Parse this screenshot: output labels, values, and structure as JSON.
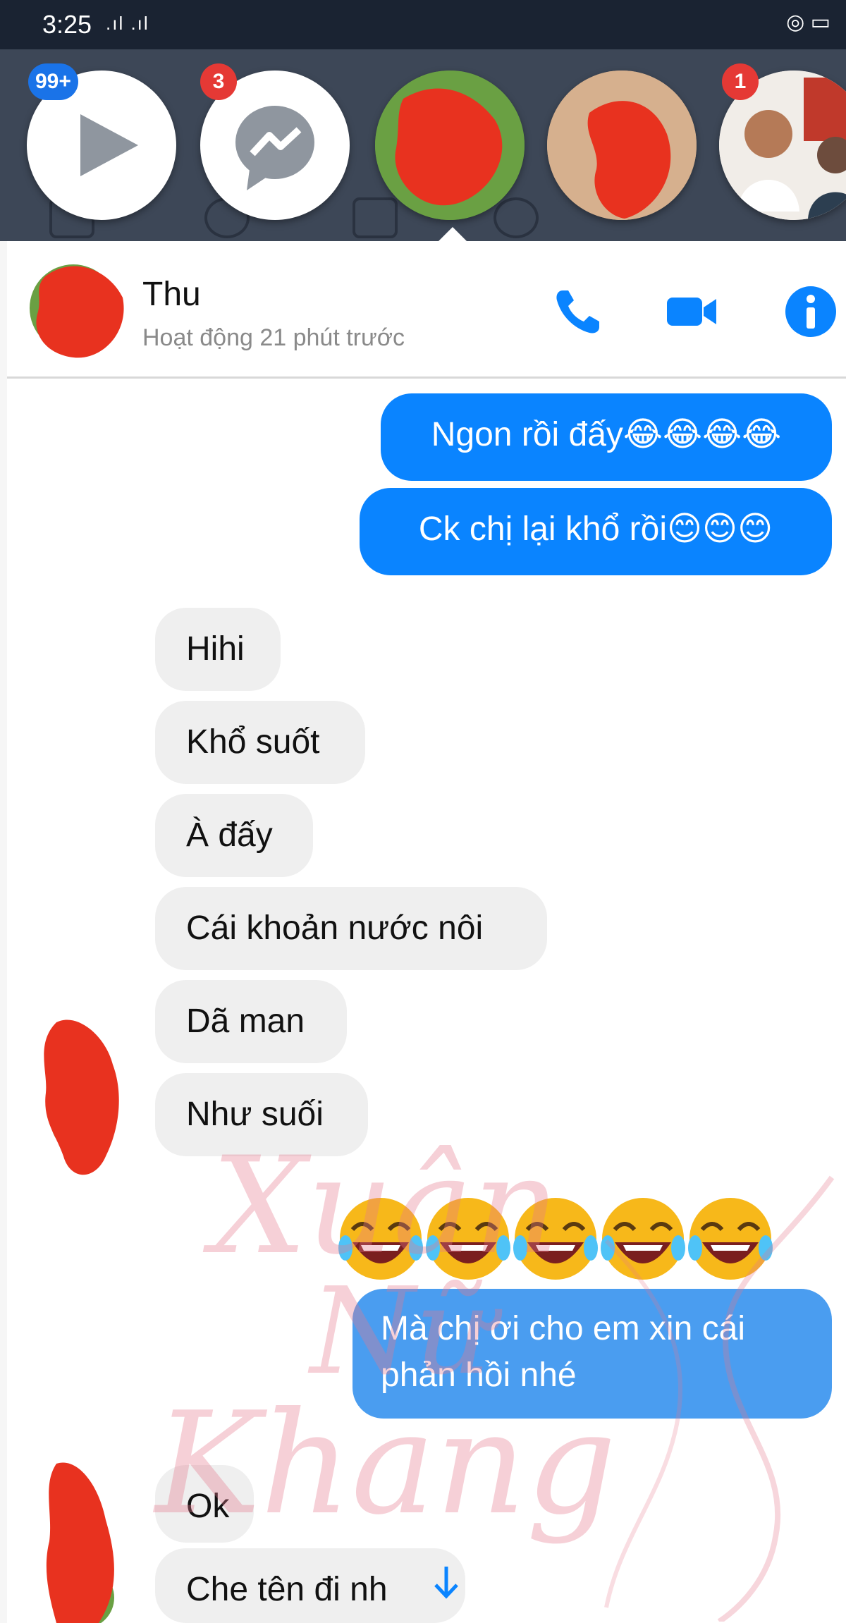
{
  "status_bar": {
    "time": "3:25",
    "signal": ".ıl .ıl",
    "right": "◎ ▭"
  },
  "chat_heads": [
    {
      "icon": "play-icon",
      "badge": "99+",
      "badge_color": "#1a73e8"
    },
    {
      "icon": "messenger-icon",
      "badge": "3",
      "badge_color": "#e53935"
    },
    {
      "icon": "avatar-redacted"
    },
    {
      "icon": "avatar-redacted"
    },
    {
      "icon": "avatar-photo",
      "badge": "1",
      "badge_color": "#e53935"
    }
  ],
  "header": {
    "name": "Thu",
    "status": "Hoạt động 21 phút trước",
    "icons": [
      "phone-icon",
      "video-icon",
      "info-icon"
    ],
    "accent": "#0a84ff"
  },
  "messages": [
    {
      "side": "out",
      "text": "Ngon rồi đấy😂😂😂😂"
    },
    {
      "side": "out",
      "text": "Ck chị lại khổ rồi😊😊😊"
    },
    {
      "side": "in",
      "text": "Hihi"
    },
    {
      "side": "in",
      "text": "Khổ suốt"
    },
    {
      "side": "in",
      "text": "À đấy"
    },
    {
      "side": "in",
      "text": "Cái khoản nước nôi"
    },
    {
      "side": "in",
      "text": "Dã man"
    },
    {
      "side": "in",
      "text": "Như suối"
    },
    {
      "side": "out-emoji",
      "text": "😂😂😂😂😂"
    },
    {
      "side": "out",
      "text_line1": "Mà chị ơi cho em xin cái",
      "text_line2": "phản hồi nhé"
    },
    {
      "side": "in",
      "text": "Ok"
    },
    {
      "side": "in",
      "text": "Che tên đi nh"
    }
  ],
  "watermark": {
    "line1": "Xuân",
    "line2": "Nữ",
    "line3": "Khang"
  },
  "colors": {
    "outgoing": "#0a84ff",
    "incoming": "#efefef",
    "redaction": "#e8321f"
  }
}
